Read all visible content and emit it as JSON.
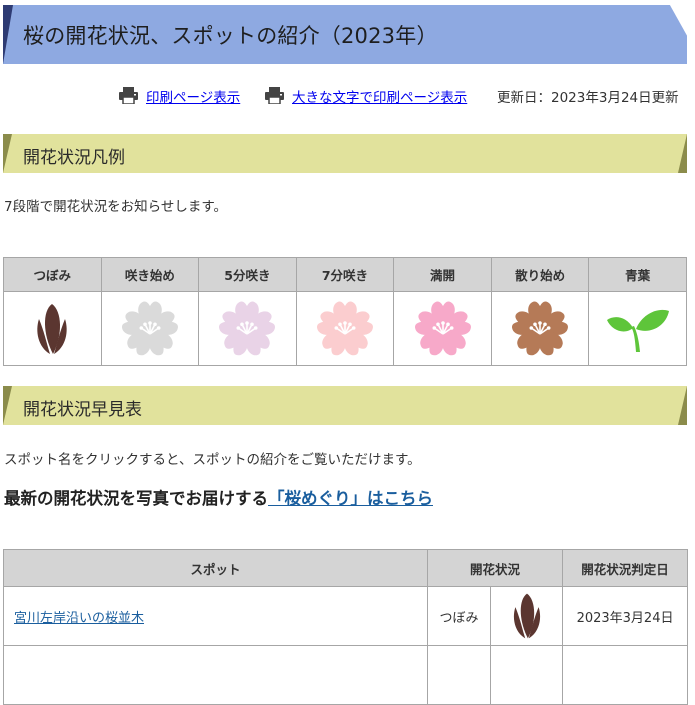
{
  "page": {
    "title": "桜の開花状況、スポットの紹介（2023年）",
    "print_link": "印刷ページ表示",
    "large_print_link": "大きな文字で印刷ページ表示",
    "updated": "更新日：2023年3月24日更新"
  },
  "legend_section": {
    "heading": "開花状況凡例",
    "description": "7段階で開花状況をお知らせします。",
    "stages": [
      {
        "label": "つぼみ",
        "icon": "bud-icon",
        "color": "#5b3630"
      },
      {
        "label": "咲き始め",
        "icon": "sakura-icon",
        "color": "#dadada"
      },
      {
        "label": "5分咲き",
        "icon": "sakura-icon",
        "color": "#e9d3e7"
      },
      {
        "label": "7分咲き",
        "icon": "sakura-icon",
        "color": "#fbcdcf"
      },
      {
        "label": "満開",
        "icon": "sakura-icon",
        "color": "#f7a9c9"
      },
      {
        "label": "散り始め",
        "icon": "sakura-icon",
        "color": "#b57a57"
      },
      {
        "label": "青葉",
        "icon": "leaf-icon",
        "color": "#5ec53a"
      }
    ]
  },
  "quick_section": {
    "heading": "開花状況早見表",
    "description": "スポット名をクリックすると、スポットの紹介をご覧いただけます。",
    "promo_text": "最新の開花状況を写真でお届けする",
    "promo_link": "「桜めぐり」はこちら"
  },
  "spots_table": {
    "headers": [
      "スポット",
      "開花状況",
      "開花状況判定日"
    ],
    "rows": [
      {
        "name": "宮川左岸沿いの桜並木",
        "status": "つぼみ",
        "status_icon": "bud-icon",
        "date": "2023年3月24日"
      }
    ]
  }
}
